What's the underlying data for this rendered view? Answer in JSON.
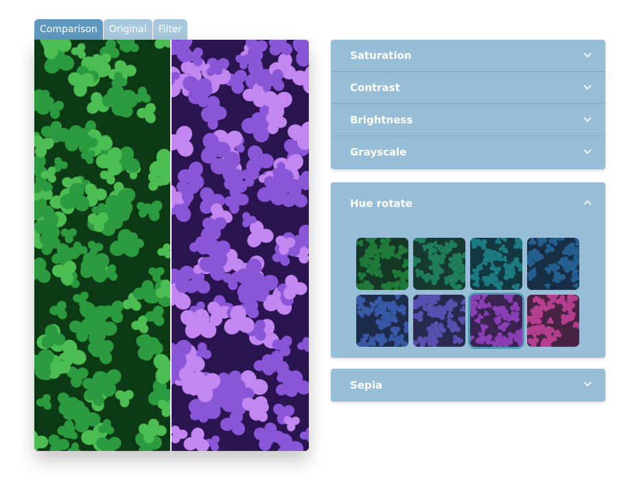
{
  "tabs": [
    {
      "label": "Comparison",
      "active": true
    },
    {
      "label": "Original",
      "active": false
    },
    {
      "label": "Filter",
      "active": false
    }
  ],
  "viewer": {
    "left_tint": "#1c7a2c",
    "right_tint": "#8a4fd6"
  },
  "accordion": {
    "items": [
      {
        "label": "Saturation",
        "icon": "chevron-down-icon"
      },
      {
        "label": "Contrast",
        "icon": "chevron-down-icon"
      },
      {
        "label": "Brightness",
        "icon": "chevron-down-icon"
      },
      {
        "label": "Grayscale",
        "icon": "chevron-down-icon"
      }
    ],
    "hue": {
      "label": "Hue rotate",
      "icon": "chevron-up-icon",
      "swatches": [
        {
          "color": "#1f7a3a",
          "selected": false
        },
        {
          "color": "#1f7f5a",
          "selected": false
        },
        {
          "color": "#1d7b82",
          "selected": false
        },
        {
          "color": "#245f8f",
          "selected": false
        },
        {
          "color": "#3a58a6",
          "selected": false
        },
        {
          "color": "#5a4fb0",
          "selected": false
        },
        {
          "color": "#8a3fb4",
          "selected": true
        },
        {
          "color": "#b4408f",
          "selected": false
        }
      ]
    },
    "sepia": {
      "label": "Sepia",
      "icon": "chevron-down-icon"
    }
  },
  "colors": {
    "accent": "#5f97be",
    "panel": "#97bdd7",
    "tab_inactive": "#a7c7dd"
  }
}
